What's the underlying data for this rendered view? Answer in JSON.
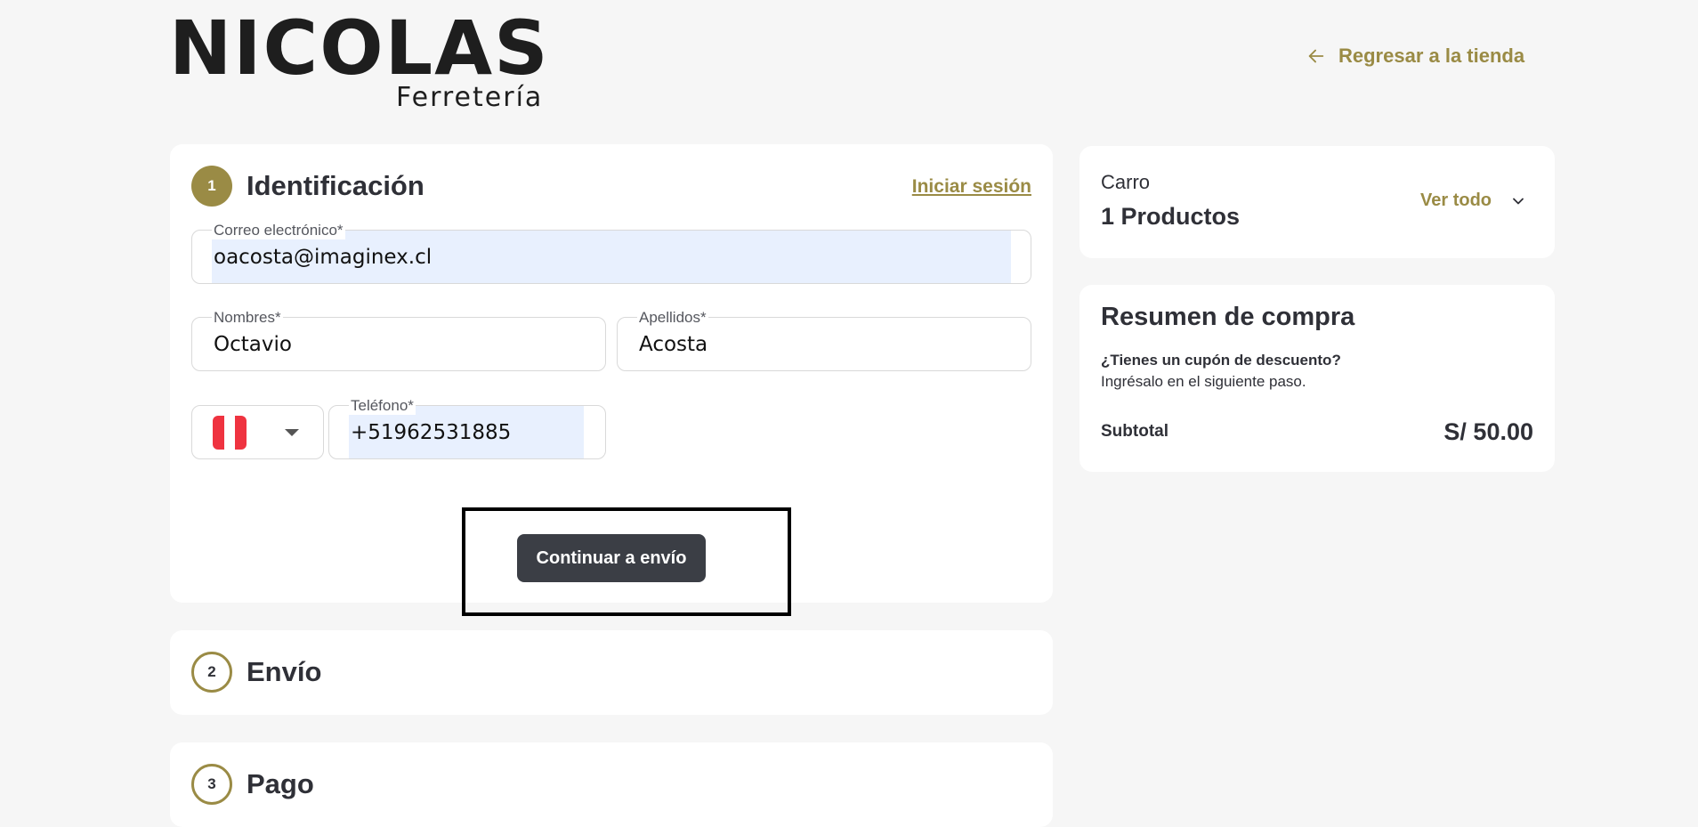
{
  "header": {
    "logo_main": "NICOLAS",
    "logo_sub": "Ferretería",
    "back_link": "Regresar a la tienda"
  },
  "identification": {
    "step": "1",
    "title": "Identificación",
    "login_link": "Iniciar sesión",
    "email": {
      "label": "Correo electrónico*",
      "value": "oacosta@imaginex.cl"
    },
    "nombres": {
      "label": "Nombres*",
      "value": "Octavio"
    },
    "apellidos": {
      "label": "Apellidos*",
      "value": "Acosta"
    },
    "phone": {
      "label": "Teléfono*",
      "value": "+51962531885",
      "country_flag": "peru-flag-icon"
    },
    "continue_button": "Continuar a envío"
  },
  "shipping": {
    "step": "2",
    "title": "Envío"
  },
  "payment": {
    "step": "3",
    "title": "Pago"
  },
  "cart": {
    "label": "Carro",
    "count": "1 Productos",
    "see_all": "Ver todo"
  },
  "summary": {
    "title": "Resumen de compra",
    "coupon_question": "¿Tienes un cupón de descuento?",
    "coupon_hint": "Ingrésalo en el siguiente paso.",
    "subtotal_label": "Subtotal",
    "subtotal_value": "S/ 50.00"
  },
  "colors": {
    "accent": "#9a8b45",
    "button": "#3b3e45",
    "background": "#f6f6f6",
    "autofill": "#e8f0fe"
  }
}
